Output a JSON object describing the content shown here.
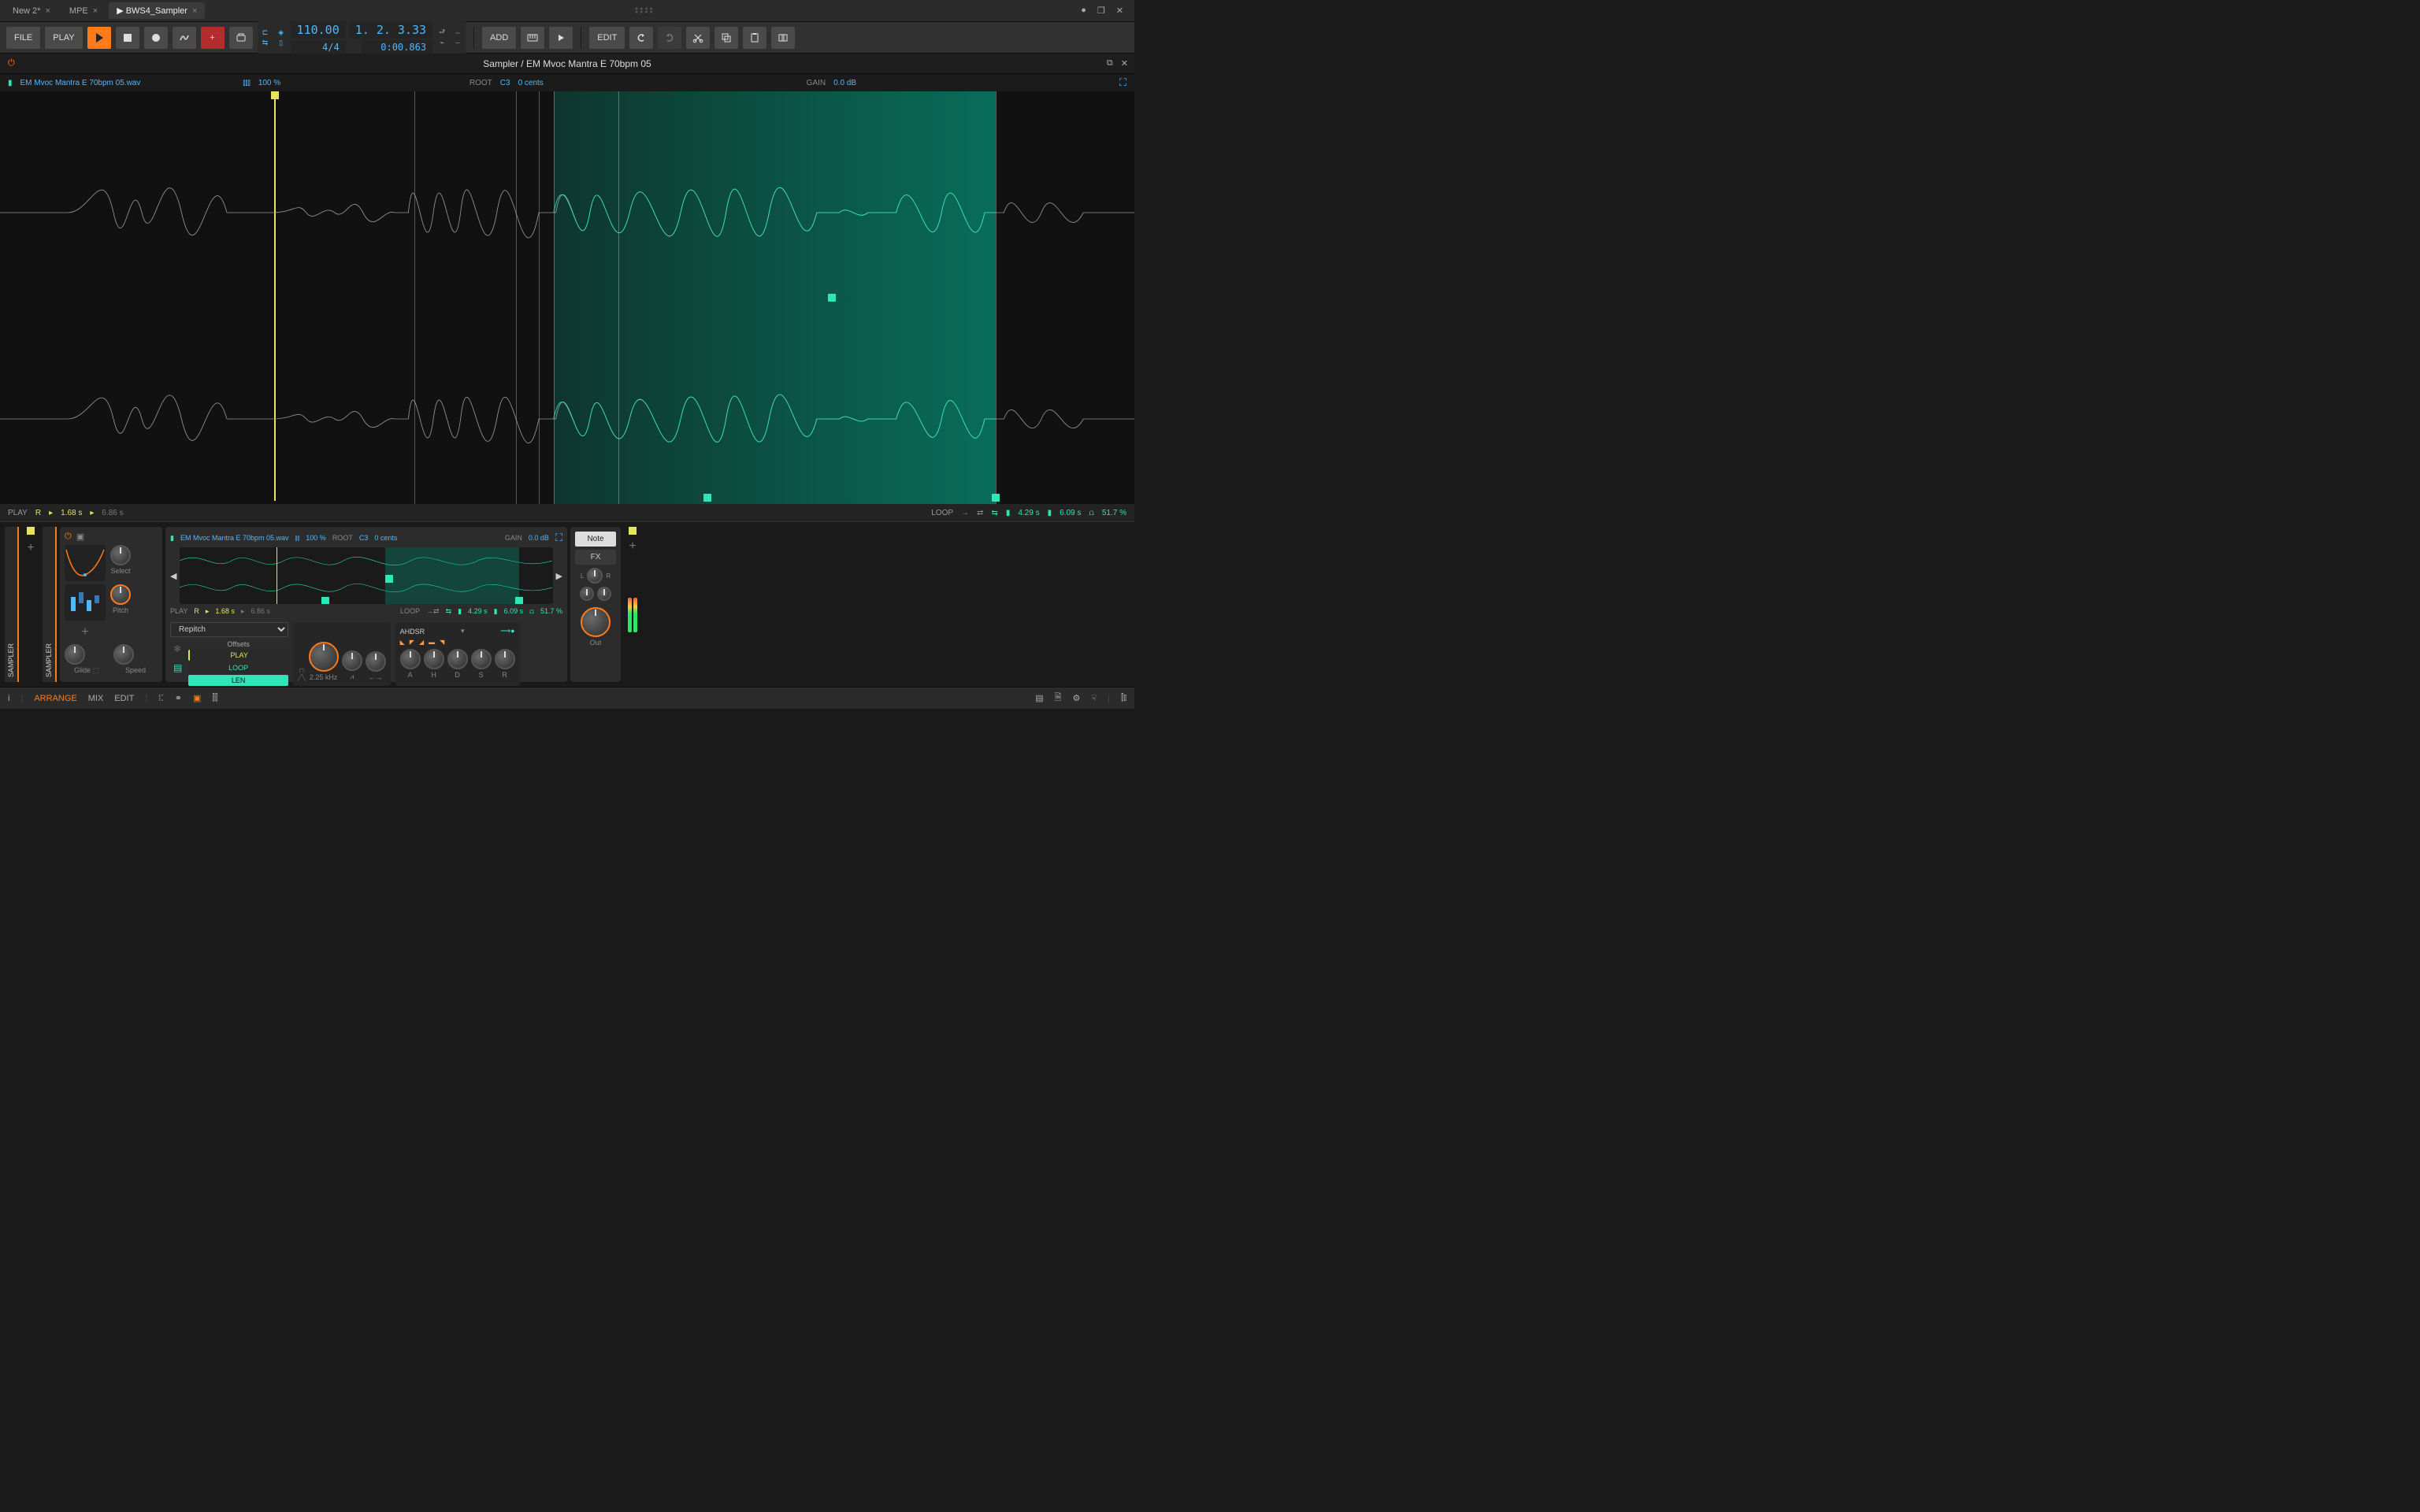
{
  "tabs": [
    {
      "label": "New 2*",
      "active": false
    },
    {
      "label": "MPE",
      "active": false
    },
    {
      "label": "▶  BWS4_Sampler",
      "active": true
    }
  ],
  "toolbar": {
    "file": "FILE",
    "play": "PLAY",
    "add": "ADD",
    "edit": "EDIT"
  },
  "transport": {
    "tempo": "110.00",
    "sig": "4/4",
    "pos_bars": "1. 2. 3.33",
    "pos_time": "0:00.863"
  },
  "editor": {
    "title": "Sampler / EM Mvoc Mantra E 70bpm 05",
    "filename": "EM Mvoc Mantra E 70bpm 05.wav",
    "zoom": "100 %",
    "root_label": "ROOT",
    "root_note": "C3",
    "cents": "0 cents",
    "gain_label": "GAIN",
    "gain": "0.0 dB"
  },
  "play_row": {
    "label": "PLAY",
    "r": "R",
    "start": "1.68 s",
    "end": "6.86 s"
  },
  "loop_row": {
    "label": "LOOP",
    "start": "4.29 s",
    "end": "6.09 s",
    "pct": "51.7 %"
  },
  "device": {
    "filename": "EM Mvoc Mantra E 70bpm 05.wav",
    "zoom": "100 %",
    "root_label": "ROOT",
    "root_note": "C3",
    "cents": "0 cents",
    "gain_label": "GAIN",
    "gain": "0.0 dB",
    "play": {
      "label": "PLAY",
      "r": "R",
      "start": "1.68 s",
      "end": "6.86 s"
    },
    "loop": {
      "label": "LOOP",
      "start": "4.29 s",
      "end": "6.09 s",
      "pct": "51.7 %"
    },
    "knobs": {
      "select": "Select",
      "pitch": "Pitch",
      "glide": "Glide",
      "speed": "Speed",
      "out": "Out"
    },
    "mode": "Repitch",
    "offsets": {
      "title": "Offsets",
      "play": "PLAY",
      "loop": "LOOP",
      "len": "LEN"
    },
    "filter_freq": "2.25 kHz",
    "ahdsr": {
      "title": "AHDSR",
      "a": "A",
      "h": "H",
      "d": "D",
      "s": "S",
      "r": "R"
    },
    "tabs": {
      "note": "Note",
      "fx": "FX"
    },
    "pan": {
      "l": "L",
      "r": "R"
    },
    "sampler": "SAMPLER"
  },
  "footer": {
    "arrange": "ARRANGE",
    "mix": "MIX",
    "edit": "EDIT",
    "info": "i"
  }
}
